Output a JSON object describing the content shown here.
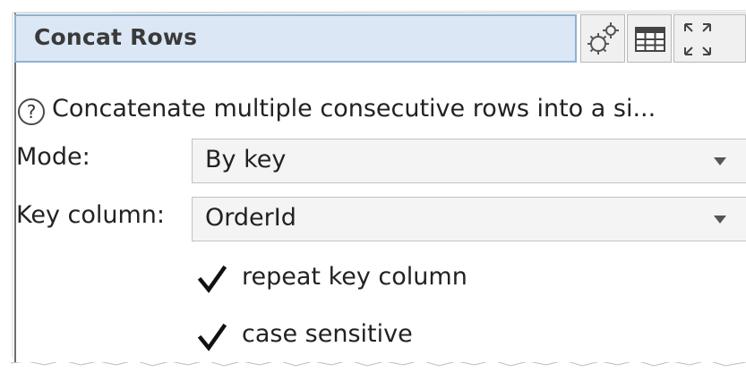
{
  "panel": {
    "title": "Concat Rows",
    "title_buttons": [
      {
        "name": "settings",
        "icon": "gear-icon"
      },
      {
        "name": "table",
        "icon": "table-icon"
      },
      {
        "name": "maximize",
        "icon": "expand-icon"
      }
    ],
    "help_glyph": "?",
    "description": "Concatenate multiple consecutive rows into a si..."
  },
  "form": {
    "mode_label": "Mode:",
    "mode_value": "By key",
    "key_column_label": "Key column:",
    "key_column_value": "OrderId",
    "repeat_key_column_label": "repeat key column",
    "repeat_key_column_checked": true,
    "case_sensitive_label": "case sensitive",
    "case_sensitive_checked": true
  },
  "colors": {
    "title_bg": "#dbe7f5",
    "title_border": "#8fb0d6",
    "combo_bg": "#f4f4f4"
  }
}
